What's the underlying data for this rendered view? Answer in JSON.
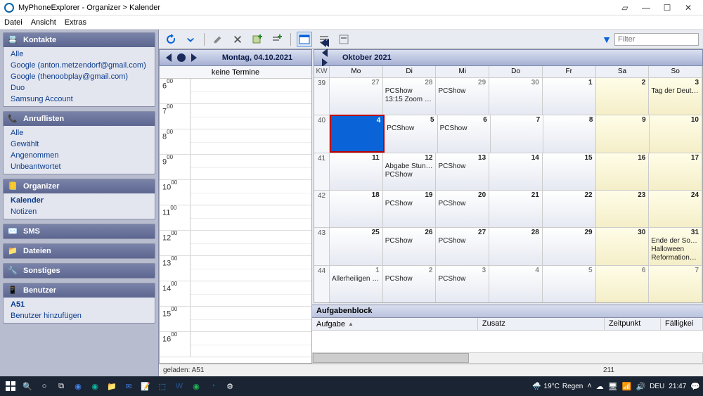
{
  "app": {
    "title": "MyPhoneExplorer -   Organizer > Kalender"
  },
  "menu": {
    "file": "Datei",
    "view": "Ansicht",
    "extras": "Extras"
  },
  "sidebar": {
    "contacts": {
      "title": "Kontakte",
      "items": [
        "Alle",
        "Google (anton.metzendorf@gmail.com)",
        "Google (thenoobplay@gmail.com)",
        "Duo",
        "Samsung Account"
      ]
    },
    "calllists": {
      "title": "Anruflisten",
      "items": [
        "Alle",
        "Gewählt",
        "Angenommen",
        "Unbeantwortet"
      ]
    },
    "organizer": {
      "title": "Organizer",
      "items": [
        "Kalender",
        "Notizen"
      ],
      "active": 0
    },
    "sms": {
      "title": "SMS"
    },
    "files": {
      "title": "Dateien"
    },
    "misc": {
      "title": "Sonstiges"
    },
    "user": {
      "title": "Benutzer",
      "items": [
        "A51",
        "Benutzer hinzufügen"
      ],
      "active": 0
    }
  },
  "filter": {
    "placeholder": "Filter"
  },
  "daynav": {
    "label": "Montag, 04.10.2021"
  },
  "monthnav": {
    "label": "Oktober 2021"
  },
  "daycol": {
    "empty": "keine Termine",
    "hours": [
      "6",
      "7",
      "8",
      "9",
      "10",
      "11",
      "12",
      "13",
      "14",
      "15",
      "16"
    ]
  },
  "month": {
    "kw_label": "KW",
    "daynames": [
      "Mo",
      "Di",
      "Mi",
      "Do",
      "Fr",
      "Sa",
      "So"
    ],
    "weeks": [
      {
        "kw": "39",
        "days": [
          {
            "n": "27",
            "dim": true
          },
          {
            "n": "28",
            "dim": true,
            "ev": [
              "PCShow",
              "13:15 Zoom Leh..."
            ]
          },
          {
            "n": "29",
            "dim": true,
            "ev": [
              "PCShow"
            ]
          },
          {
            "n": "30",
            "dim": true
          },
          {
            "n": "1"
          },
          {
            "n": "2",
            "we": true
          },
          {
            "n": "3",
            "we": true,
            "ev": [
              "Tag der Deutsch..."
            ]
          }
        ]
      },
      {
        "kw": "40",
        "days": [
          {
            "n": "4",
            "today": true
          },
          {
            "n": "5",
            "ev": [
              "PCShow"
            ]
          },
          {
            "n": "6",
            "ev": [
              "PCShow"
            ]
          },
          {
            "n": "7"
          },
          {
            "n": "8"
          },
          {
            "n": "9",
            "we": true
          },
          {
            "n": "10",
            "we": true
          }
        ]
      },
      {
        "kw": "41",
        "days": [
          {
            "n": "11"
          },
          {
            "n": "12",
            "ev": [
              "Abgabe Stunde...",
              "PCShow"
            ]
          },
          {
            "n": "13",
            "ev": [
              "PCShow"
            ]
          },
          {
            "n": "14"
          },
          {
            "n": "15"
          },
          {
            "n": "16",
            "we": true
          },
          {
            "n": "17",
            "we": true
          }
        ]
      },
      {
        "kw": "42",
        "days": [
          {
            "n": "18"
          },
          {
            "n": "19",
            "ev": [
              "PCShow"
            ]
          },
          {
            "n": "20",
            "ev": [
              "PCShow"
            ]
          },
          {
            "n": "21"
          },
          {
            "n": "22"
          },
          {
            "n": "23",
            "we": true
          },
          {
            "n": "24",
            "we": true
          }
        ]
      },
      {
        "kw": "43",
        "days": [
          {
            "n": "25"
          },
          {
            "n": "26",
            "ev": [
              "PCShow"
            ]
          },
          {
            "n": "27",
            "ev": [
              "PCShow"
            ]
          },
          {
            "n": "28"
          },
          {
            "n": "29"
          },
          {
            "n": "30",
            "we": true
          },
          {
            "n": "31",
            "we": true,
            "ev": [
              "Ende der Somm...",
              "Halloween",
              "Reformationsta..."
            ]
          }
        ]
      },
      {
        "kw": "44",
        "days": [
          {
            "n": "1",
            "dim": true,
            "ev": [
              "Allerheiligen (re..."
            ]
          },
          {
            "n": "2",
            "dim": true,
            "ev": [
              "PCShow"
            ]
          },
          {
            "n": "3",
            "dim": true,
            "ev": [
              "PCShow"
            ]
          },
          {
            "n": "4",
            "dim": true
          },
          {
            "n": "5",
            "dim": true
          },
          {
            "n": "6",
            "dim": true,
            "we": true
          },
          {
            "n": "7",
            "dim": true,
            "we": true
          }
        ]
      }
    ]
  },
  "tasks": {
    "title": "Aufgabenblock",
    "cols": [
      "Aufgabe",
      "Zusatz",
      "Zeitpunkt",
      "Fälligkei"
    ]
  },
  "status": {
    "loaded": "geladen: A51",
    "count": "211"
  },
  "taskbar": {
    "weather_temp": "19°C",
    "weather_cond": "Regen",
    "lang": "DEU",
    "time": "21:47"
  }
}
